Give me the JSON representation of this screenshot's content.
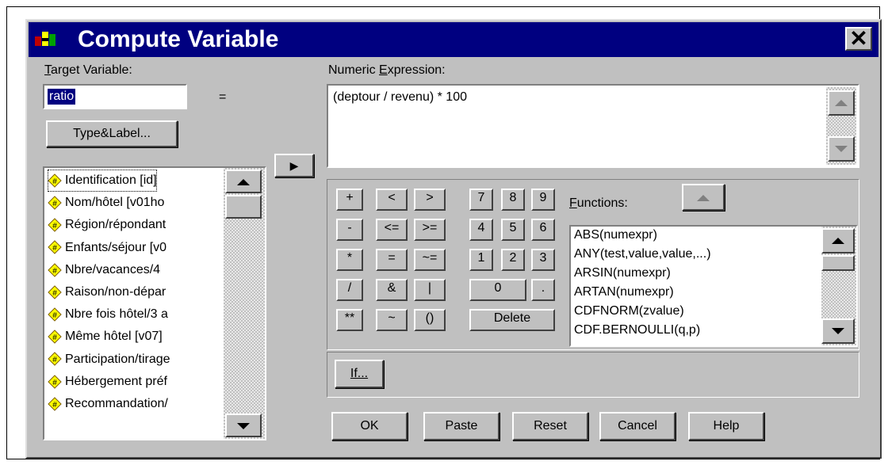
{
  "window": {
    "title": "Compute Variable",
    "close_label": "✕"
  },
  "target": {
    "label": "Target Variable:",
    "value": "ratio",
    "equals": "="
  },
  "type_label_button": "Type&Label...",
  "move_button": "▶",
  "expression": {
    "label": "Numeric Expression:",
    "value": "(deptour / revenu) * 100"
  },
  "variables": [
    "Identification [id]",
    "Nom/hôtel [v01ho",
    "Région/répondant",
    "Enfants/séjour [v0",
    "Nbre/vacances/4",
    "Raison/non-dépar",
    "Nbre fois hôtel/3 a",
    "Même hôtel [v07]",
    "Participation/tirage",
    "Hébergement préf",
    "Recommandation/"
  ],
  "keypad": {
    "row1": [
      "+",
      "<",
      ">",
      "7",
      "8",
      "9"
    ],
    "row2": [
      "-",
      "<=",
      ">=",
      "4",
      "5",
      "6"
    ],
    "row3": [
      "*",
      "=",
      "~=",
      "1",
      "2",
      "3"
    ],
    "row4": [
      "/",
      "&",
      "|",
      "0",
      "."
    ],
    "row5": [
      "**",
      "~",
      "()",
      "Delete"
    ]
  },
  "functions": {
    "label": "Functions:",
    "items": [
      "ABS(numexpr)",
      "ANY(test,value,value,...)",
      "ARSIN(numexpr)",
      "ARTAN(numexpr)",
      "CDFNORM(zvalue)",
      "CDF.BERNOULLI(q,p)"
    ]
  },
  "if_button": "If...",
  "bottom_buttons": {
    "ok": "OK",
    "paste": "Paste",
    "reset": "Reset",
    "cancel": "Cancel",
    "help": "Help"
  },
  "colors": {
    "titlebar": "#000080",
    "dialog_bg": "#c0c0c0",
    "selection": "#000080"
  }
}
